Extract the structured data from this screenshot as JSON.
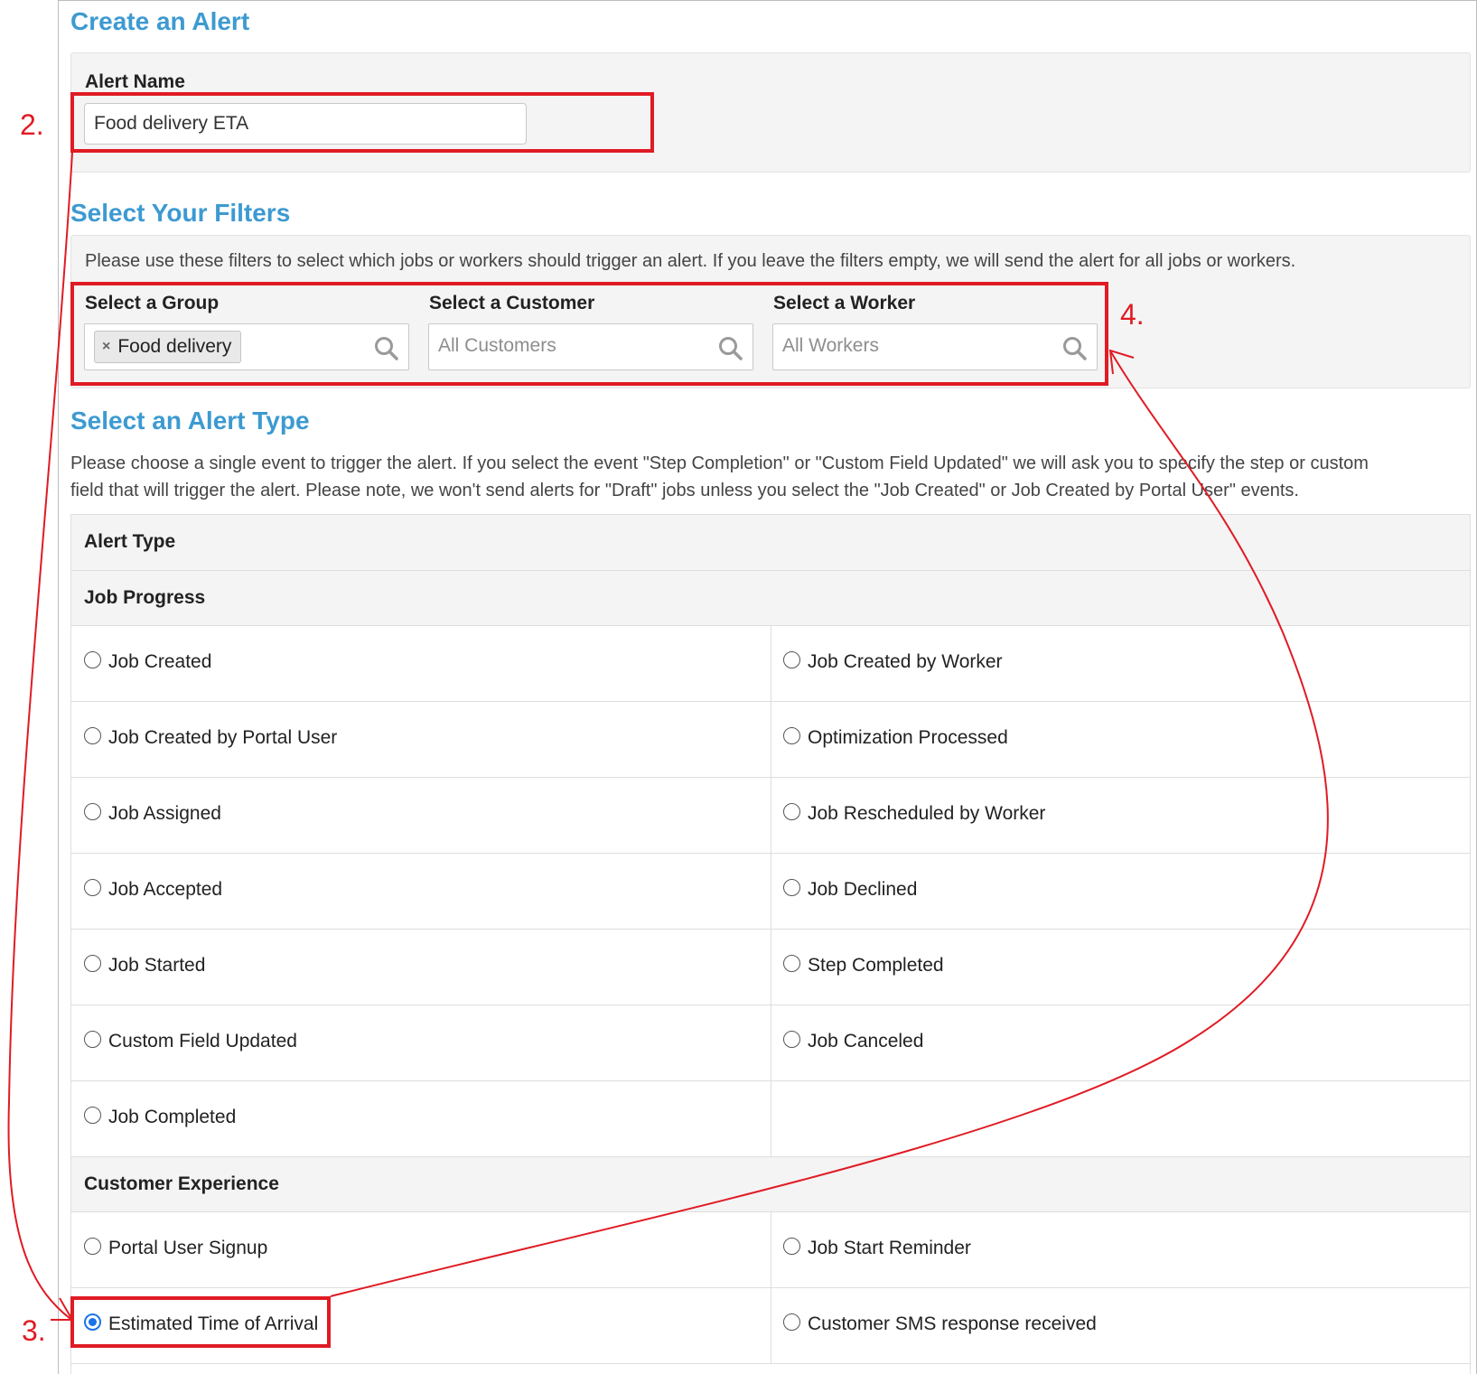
{
  "create_alert": {
    "title": "Create an Alert",
    "alert_name_label": "Alert Name",
    "alert_name_value": "Food delivery ETA"
  },
  "filters": {
    "title": "Select Your Filters",
    "description": "Please use these filters to select which jobs or workers should trigger an alert. If you leave the filters empty, we will send the alert for all jobs or workers.",
    "group": {
      "label": "Select a Group",
      "selected_tag": "Food delivery",
      "remove_glyph": "×",
      "icon": "search-icon"
    },
    "customer": {
      "label": "Select a Customer",
      "placeholder": "All Customers",
      "icon": "search-icon"
    },
    "worker": {
      "label": "Select a Worker",
      "placeholder": "All Workers",
      "icon": "search-icon"
    }
  },
  "alert_type": {
    "title": "Select an Alert Type",
    "description_line1": "Please choose a single event to trigger the alert. If you select the event \"Step Completion\" or \"Custom Field Updated\" we will ask you to specify the step or custom",
    "description_line2": "field that will trigger the alert. Please note, we won't send alerts for \"Draft\" jobs unless you select the \"Job Created\" or Job Created by Portal User\" events.",
    "table_header": "Alert Type",
    "groups": [
      {
        "name": "Job Progress",
        "rows": [
          [
            "Job Created",
            "Job Created by Worker"
          ],
          [
            "Job Created by Portal User",
            "Optimization Processed"
          ],
          [
            "Job Assigned",
            "Job Rescheduled by Worker"
          ],
          [
            "Job Accepted",
            "Job Declined"
          ],
          [
            "Job Started",
            "Step Completed"
          ],
          [
            "Custom Field Updated",
            "Job Canceled"
          ],
          [
            "Job Completed",
            ""
          ]
        ]
      },
      {
        "name": "Customer Experience",
        "rows": [
          [
            "Portal User Signup",
            "Job Start Reminder"
          ],
          [
            "Estimated Time of Arrival",
            "Customer SMS response received"
          ]
        ]
      }
    ],
    "selected": "Estimated Time of Arrival"
  },
  "annotations": {
    "step2": "2.",
    "step3": "3.",
    "step4": "4.",
    "color": "#e01b24"
  },
  "colors": {
    "section_title": "#3d9ad1",
    "radio_selected": "#1a73e8"
  }
}
